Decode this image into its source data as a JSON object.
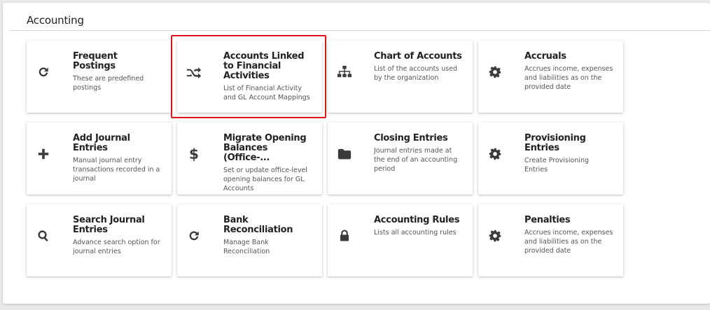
{
  "page": {
    "title": "Accounting"
  },
  "highlight": {
    "target": "accounts-linked-to-financial-activities",
    "color": "#e0151b"
  },
  "cards": [
    {
      "id": "frequent-postings",
      "icon": "refresh-icon",
      "title": "Frequent Postings",
      "description": "These are predefined postings"
    },
    {
      "id": "accounts-linked",
      "icon": "shuffle-icon",
      "title": "Accounts Linked to Financial Activities",
      "description": "List of Financial Activity and GL Account Mappings"
    },
    {
      "id": "chart-of-accounts",
      "icon": "sitemap-icon",
      "title": "Chart of Accounts",
      "description": "List of the accounts used by the organization"
    },
    {
      "id": "accruals",
      "icon": "gear-icon",
      "title": "Accruals",
      "description": "Accrues income, expenses and liabilities as on the provided date"
    },
    {
      "id": "add-journal-entries",
      "icon": "plus-icon",
      "title": "Add Journal Entries",
      "description": "Manual journal entry transactions recorded in a journal"
    },
    {
      "id": "migrate-opening-balances",
      "icon": "dollar-icon",
      "title": "Migrate Opening Balances (Office-...",
      "description": "Set or update office-level opening balances for GL Accounts"
    },
    {
      "id": "closing-entries",
      "icon": "folder-icon",
      "title": "Closing Entries",
      "description": "Journal entries made at the end of an accounting period"
    },
    {
      "id": "provisioning-entries",
      "icon": "gear-icon",
      "title": "Provisioning Entries",
      "description": "Create Provisioning Entries"
    },
    {
      "id": "search-journal-entries",
      "icon": "search-icon",
      "title": "Search Journal Entries",
      "description": "Advance search option for journal entries"
    },
    {
      "id": "bank-reconciliation",
      "icon": "refresh-icon",
      "title": "Bank Reconciliation",
      "description": "Manage Bank Reconciliation"
    },
    {
      "id": "accounting-rules",
      "icon": "lock-icon",
      "title": "Accounting Rules",
      "description": "Lists all accounting rules"
    },
    {
      "id": "penalties",
      "icon": "gear-icon",
      "title": "Penalties",
      "description": "Accrues income, expenses and liabilities as on the provided date"
    }
  ]
}
